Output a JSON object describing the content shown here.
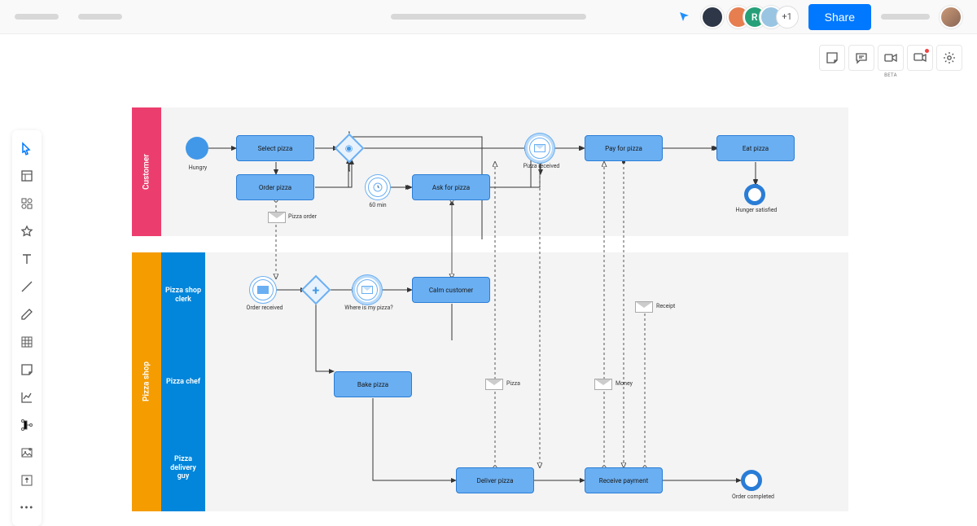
{
  "header": {
    "plus_count": "+1",
    "share_label": "Share"
  },
  "sec_toolbar": {
    "beta_label": "BETA"
  },
  "lanes": {
    "customer": "Customer",
    "pizza_shop": "Pizza shop",
    "clerk": "Pizza shop clerk",
    "chef": "Pizza chef",
    "delivery": "Pizza delivery guy"
  },
  "nodes": {
    "hungry": "Hungry",
    "select_pizza": "Select pizza",
    "order_pizza": "Order pizza",
    "pizza_order": "Pizza order",
    "sixty_min": "60 min",
    "ask_for_pizza": "Ask for pizza",
    "pizza_received": "Pizza received",
    "pay_for_pizza": "Pay for pizza",
    "eat_pizza": "Eat pizza",
    "hunger_satisfied": "Hunger satisfied",
    "order_received": "Order received",
    "calm_customer": "Calm customer",
    "where_is_my_pizza": "Where is my pizza?",
    "receipt": "Receipt",
    "bake_pizza": "Bake pizza",
    "pizza": "Pizza",
    "money": "Money",
    "deliver_pizza": "Deliver pizza",
    "receive_payment": "Receive payment",
    "order_completed": "Order completed"
  },
  "accent_colors": {
    "customer_lane": "#ec3e6e",
    "shop_lane": "#f59c00",
    "sublane": "#0186db",
    "task_fill": "#6aaff2",
    "primary_blue": "#0078ff"
  }
}
